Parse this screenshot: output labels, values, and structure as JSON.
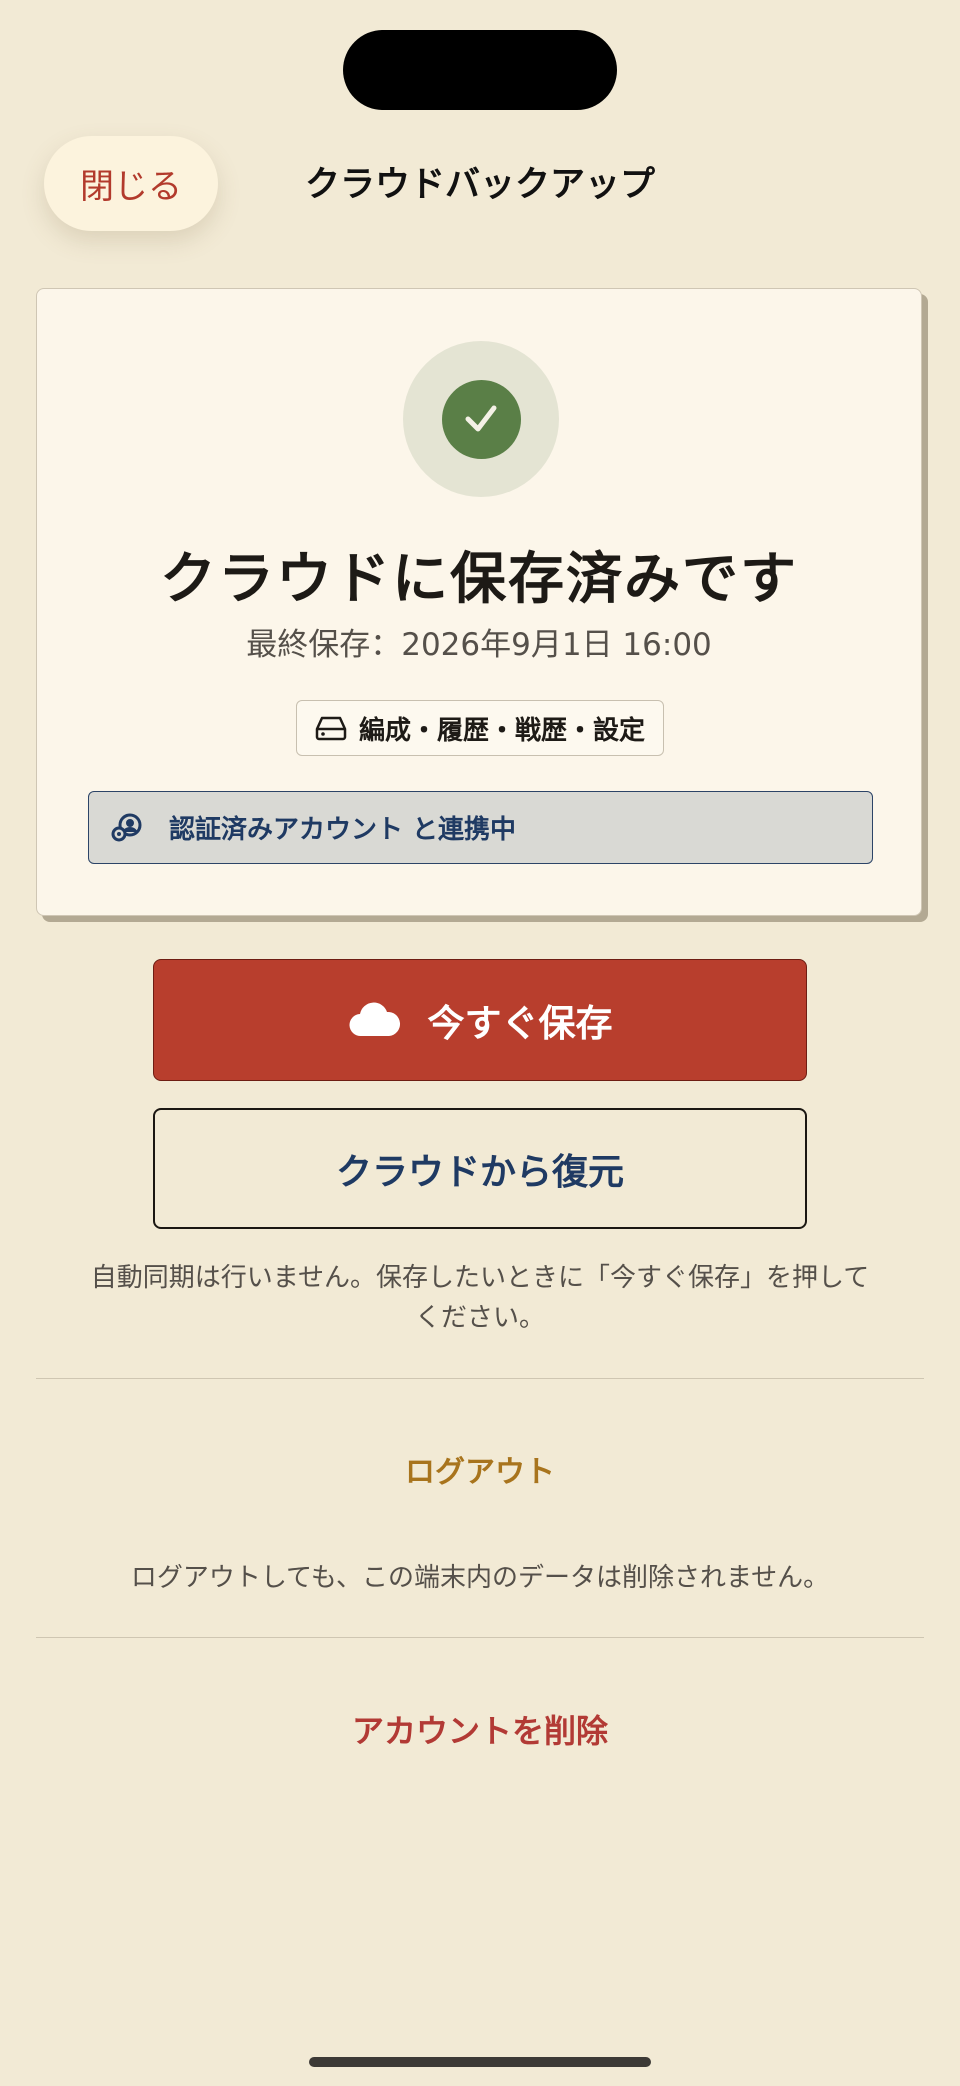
{
  "nav": {
    "close_label": "閉じる",
    "title": "クラウドバックアップ"
  },
  "status_card": {
    "title": "クラウドに保存済みです",
    "last_saved": "最終保存：2026年9月1日 16:00",
    "scope_label": "編成・履歴・戦歴・設定",
    "account_label": "認証済みアカウント と連携中",
    "icons": {
      "status": "check-icon",
      "scope": "storage-icon",
      "account": "account-link-icon"
    }
  },
  "actions": {
    "save_now_label": "今すぐ保存",
    "restore_label": "クラウドから復元",
    "note": "自動同期は行いません。保存したいときに「今すぐ保存」を押してください。"
  },
  "logout": {
    "label": "ログアウト",
    "note": "ログアウトしても、この端末内のデータは削除されません。"
  },
  "delete": {
    "label": "アカウントを削除"
  },
  "colors": {
    "background": "#f2ead5",
    "primary": "#b83e2d",
    "success": "#5a7f47",
    "navy": "#1f3a63",
    "gold": "#a8741d"
  }
}
